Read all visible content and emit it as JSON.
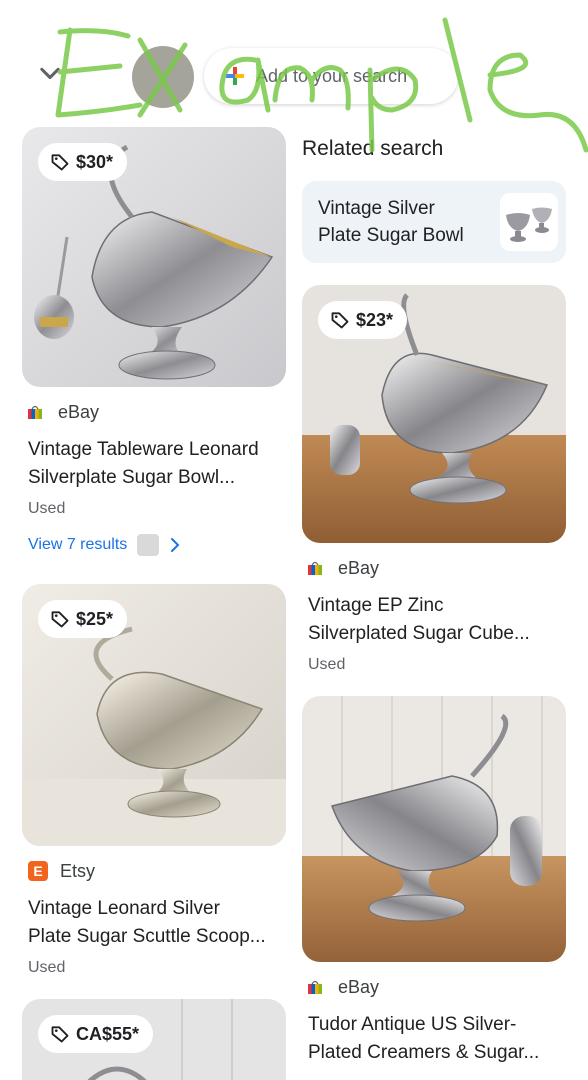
{
  "header": {
    "search_placeholder": "Add to your search"
  },
  "watermark_text": "Example",
  "left_column": [
    {
      "price": "$30*",
      "source": "eBay",
      "source_icon": "ebay-bag-icon",
      "title_line1": "Vintage Tableware Leonard",
      "title_line2": "Silverplate Sugar Bowl...",
      "condition": "Used",
      "view_results": "View 7 results"
    },
    {
      "price": "$25*",
      "source": "Etsy",
      "source_icon": "etsy-e-icon",
      "source_icon_letter": "E",
      "title_line1": "Vintage Leonard Silver",
      "title_line2": "Plate Sugar Scuttle Scoop...",
      "condition": "Used"
    },
    {
      "price": "CA$55*"
    }
  ],
  "right_column": {
    "related_heading": "Related search",
    "related_line1": "Vintage Silver",
    "related_line2": "Plate Sugar Bowl",
    "items": [
      {
        "price": "$23*",
        "source": "eBay",
        "title_line1": "Vintage EP Zinc",
        "title_line2": "Silverplated Sugar Cube...",
        "condition": "Used"
      },
      {
        "source": "eBay",
        "title_line1": "Tudor Antique US Silver-",
        "title_line2": "Plated Creamers & Sugar..."
      }
    ]
  },
  "colors": {
    "link": "#1a73e8",
    "etsy": "#f1641e",
    "related_bg": "#eef3f8",
    "scribble": "#7ac94a"
  }
}
